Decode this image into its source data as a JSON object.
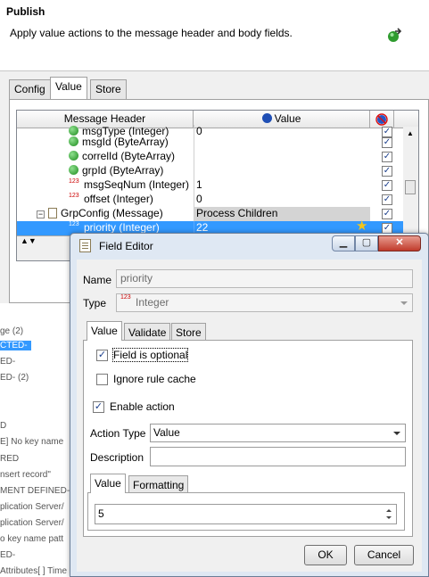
{
  "publish": {
    "title": "Publish",
    "description": "Apply value actions to the message header and body fields.",
    "tabs": [
      "Config",
      "Value",
      "Store"
    ],
    "table": {
      "col_header": "Message Header",
      "col_value": "Value",
      "rows": [
        {
          "name": "msgType (Integer)",
          "value": "0",
          "icon": "ball"
        },
        {
          "name": "msgId (ByteArray)",
          "value": "",
          "icon": "ball"
        },
        {
          "name": "correlId (ByteArray)",
          "value": "",
          "icon": "ball"
        },
        {
          "name": "grpId (ByteArray)",
          "value": "",
          "icon": "ball"
        },
        {
          "name": "msgSeqNum (Integer)",
          "value": "1",
          "icon": "num"
        },
        {
          "name": "offset (Integer)",
          "value": "0",
          "icon": "num"
        },
        {
          "name": "GrpConfig (Message)",
          "value": "Process Children",
          "icon": "doc"
        },
        {
          "name": "priority (Integer)",
          "value": "22",
          "icon": "num"
        }
      ]
    },
    "num_icon_text": "123\n4"
  },
  "log_list": [
    "ge (2)",
    "CTED-",
    "ED-",
    "ED- (2)",
    "D",
    "E] No key name",
    "RED",
    "nsert record\"",
    "MENT DEFINED-",
    "plication Server/",
    "plication Server/",
    "o key name patt",
    "ED-",
    "Attributes[ ] Time"
  ],
  "dialog": {
    "title": "Field Editor",
    "name_label": "Name",
    "name_value": "priority",
    "type_label": "Type",
    "type_value": "Integer",
    "type_icon_text": "123\n4",
    "tabs": [
      "Value",
      "Validate",
      "Store"
    ],
    "optional_label": "Field is optional",
    "optional_checked": true,
    "ignore_cache_label": "Ignore rule cache",
    "ignore_cache_checked": false,
    "enable_action_label": "Enable action",
    "enable_action_checked": true,
    "action_type_label": "Action Type",
    "action_type_value": "Value",
    "description_label": "Description",
    "description_value": "",
    "inner_tabs": [
      "Value",
      "Formatting"
    ],
    "value": "5",
    "ok_label": "OK",
    "cancel_label": "Cancel"
  }
}
